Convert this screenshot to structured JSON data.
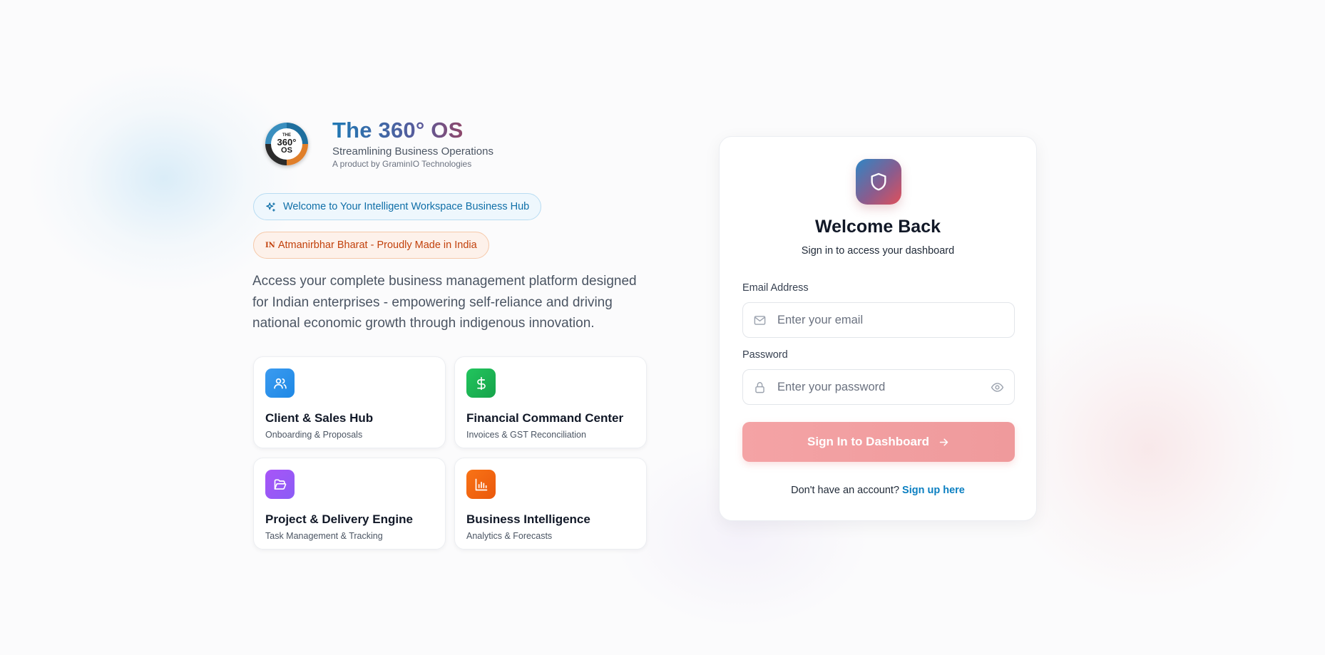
{
  "brand": {
    "logo_lines": [
      "THE",
      "360°",
      "OS"
    ],
    "title": "The 360° OS",
    "subtitle": "Streamlining Business Operations",
    "byline": "A product by GraminIO Technologies"
  },
  "badges": {
    "welcome": "Welcome to Your Intelligent Workspace Business Hub",
    "made_in_india_prefix": "IN",
    "made_in_india": "Atmanirbhar Bharat - Proudly Made in India"
  },
  "description": "Access your complete business management platform designed for Indian enterprises - empowering self-reliance and driving national economic growth through indigenous innovation.",
  "features": [
    {
      "title": "Client & Sales Hub",
      "subtitle": "Onboarding & Proposals",
      "icon": "users-icon",
      "color": "#1e88e5"
    },
    {
      "title": "Financial Command Center",
      "subtitle": "Invoices & GST Reconciliation",
      "icon": "dollar-icon",
      "color": "#16a34a"
    },
    {
      "title": "Project & Delivery Engine",
      "subtitle": "Task Management & Tracking",
      "icon": "folder-open-icon",
      "color": "#8b5cf6"
    },
    {
      "title": "Business Intelligence",
      "subtitle": "Analytics & Forecasts",
      "icon": "bar-chart-icon",
      "color": "#ea580c"
    }
  ],
  "login": {
    "title": "Welcome Back",
    "subtitle": "Sign in to access your dashboard",
    "email_label": "Email Address",
    "email_placeholder": "Enter your email",
    "email_value": "",
    "password_label": "Password",
    "password_placeholder": "Enter your password",
    "password_value": "",
    "submit_label": "Sign In to Dashboard",
    "signup_prompt": "Don't have an account?",
    "signup_link": "Sign up here"
  },
  "colors": {
    "accent_blue": "#0b7fc1",
    "button_pink": "#f4a3a5",
    "badge_blue": "#0f6fa8",
    "badge_orange": "#c2410c"
  }
}
